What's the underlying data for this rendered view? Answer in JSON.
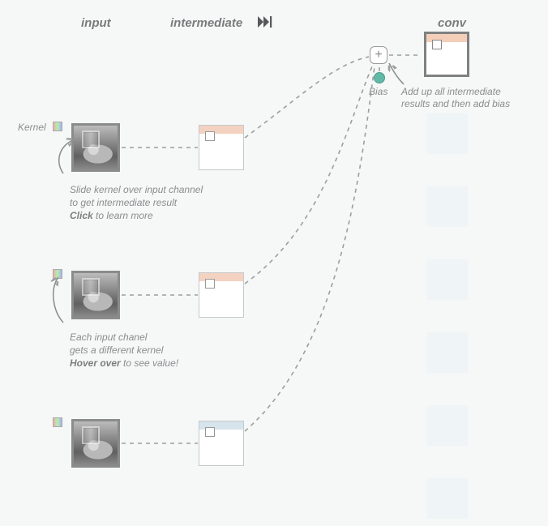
{
  "headers": {
    "input": "input",
    "intermediate": "intermediate",
    "conv": "conv"
  },
  "sum": {
    "bias_label": "Bias",
    "caption_line1": "Add up all intermediate",
    "caption_line2": "results and then add bias"
  },
  "row1": {
    "kernel_label": "Kernel",
    "cap_line1": "Slide kernel over input channel",
    "cap_line2": "to get intermediate result",
    "cap_cta": "Click",
    "cap_cta_rest": " to learn more"
  },
  "row2": {
    "cap_line1": "Each input chanel",
    "cap_line2": "gets a different kernel",
    "cap_cta": "Hover over",
    "cap_cta_rest": " to see value!"
  }
}
